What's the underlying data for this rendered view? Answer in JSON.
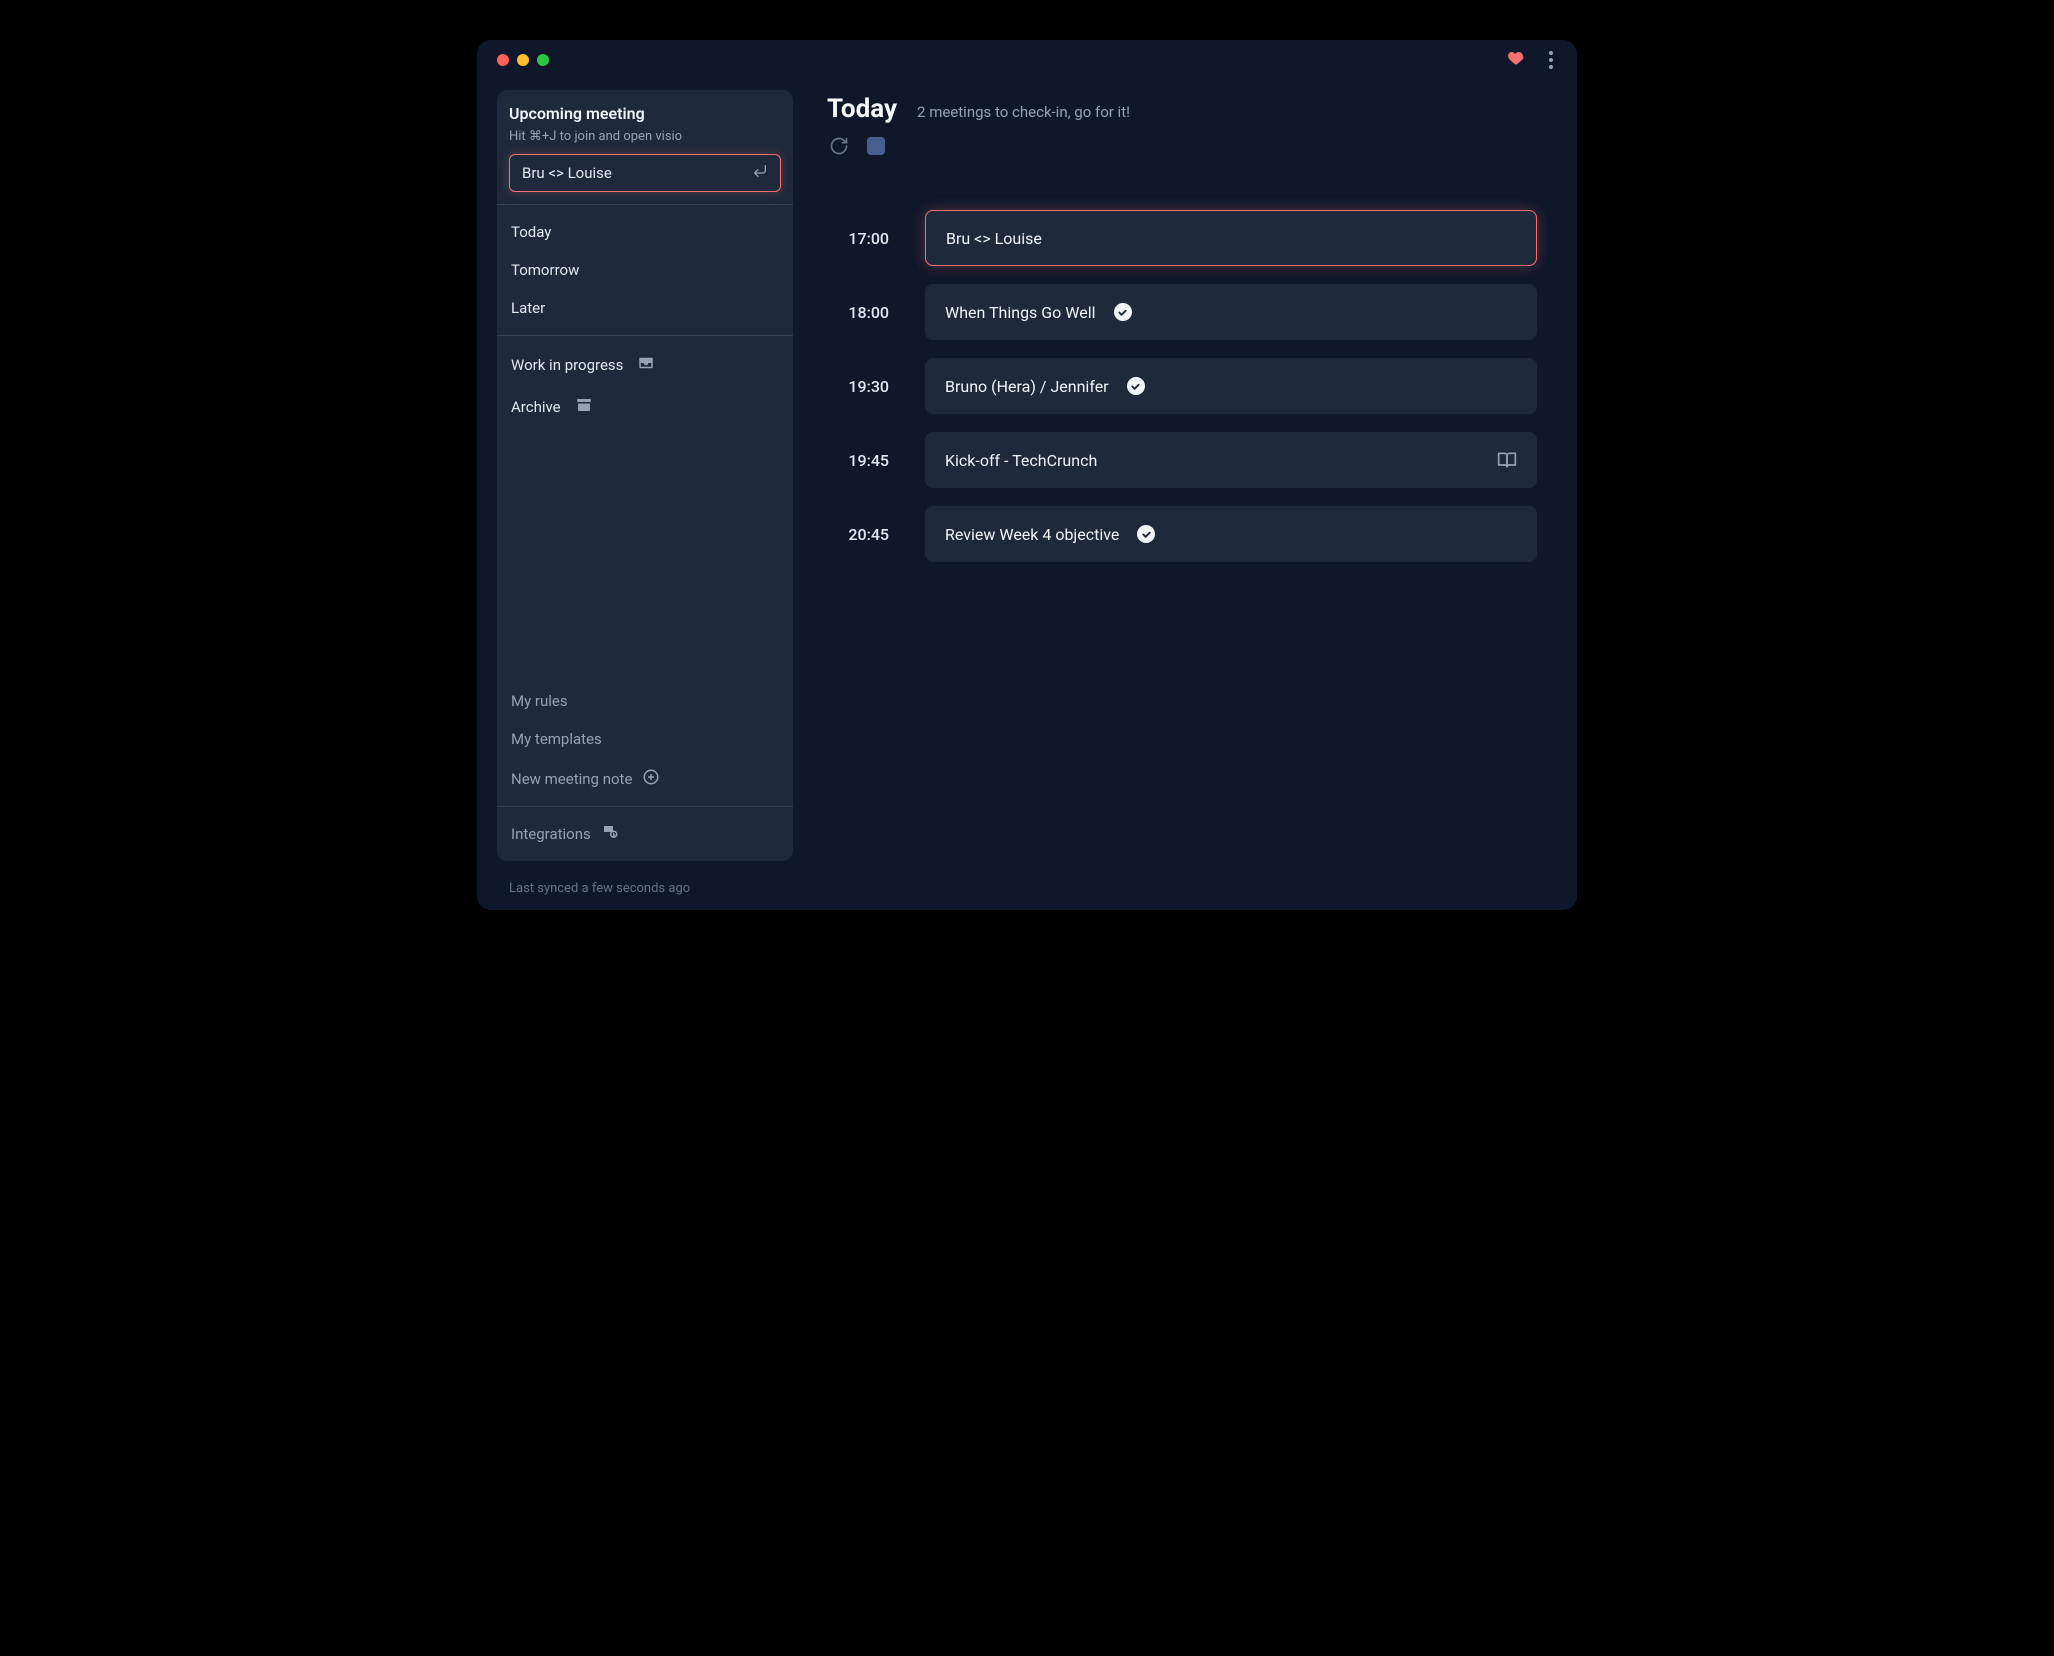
{
  "sidebar": {
    "upcoming": {
      "title": "Upcoming meeting",
      "hint": "Hit ⌘+J to join and open visio",
      "current": "Bru <> Louise"
    },
    "nav": {
      "today": "Today",
      "tomorrow": "Tomorrow",
      "later": "Later",
      "wip": "Work in progress",
      "archive": "Archive"
    },
    "bottom": {
      "rules": "My rules",
      "templates": "My templates",
      "new_note": "New meeting note",
      "integrations": "Integrations"
    }
  },
  "main": {
    "title": "Today",
    "subtitle": "2 meetings to check-in, go for it!"
  },
  "schedule": [
    {
      "time": "17:00",
      "title": "Bru <> Louise",
      "highlight": true,
      "checked": false,
      "book": false
    },
    {
      "time": "18:00",
      "title": "When Things Go Well",
      "highlight": false,
      "checked": true,
      "book": false
    },
    {
      "time": "19:30",
      "title": "Bruno (Hera) / Jennifer",
      "highlight": false,
      "checked": true,
      "book": false
    },
    {
      "time": "19:45",
      "title": "Kick-off - TechCrunch",
      "highlight": false,
      "checked": false,
      "book": true
    },
    {
      "time": "20:45",
      "title": "Review Week 4 objective",
      "highlight": false,
      "checked": true,
      "book": false
    }
  ],
  "footer": {
    "sync": "Last synced a few seconds ago"
  }
}
